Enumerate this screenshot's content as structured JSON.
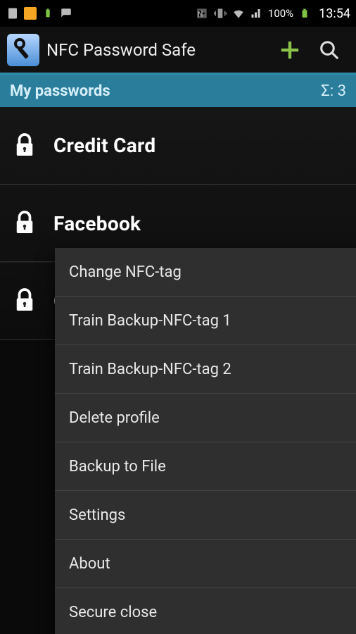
{
  "status_bar": {
    "battery_pct_left": "100",
    "battery_pct_right": "100%",
    "clock": "13:54"
  },
  "action_bar": {
    "title": "NFC Password Safe"
  },
  "subheader": {
    "title": "My passwords",
    "count": "Σ: 3"
  },
  "passwords": [
    {
      "label": "Credit Card"
    },
    {
      "label": "Facebook"
    },
    {
      "label": "G"
    }
  ],
  "context_menu": {
    "items": [
      "Change NFC-tag",
      "Train Backup-NFC-tag 1",
      "Train Backup-NFC-tag 2",
      "Delete profile",
      "Backup to File",
      "Settings",
      "About",
      "Secure close"
    ]
  }
}
